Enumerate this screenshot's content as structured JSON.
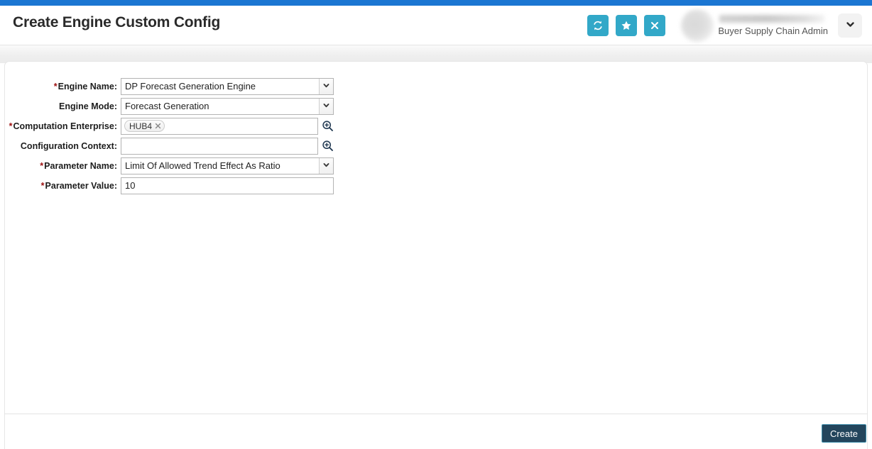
{
  "theme": {
    "accent_blue": "#1b76d2",
    "teal": "#32a8c8",
    "required_red": "#9c0f0f",
    "button_navy": "#23455c",
    "button_border": "#3d8ba8"
  },
  "header": {
    "title": "Create Engine Custom Config",
    "actions": [
      {
        "name": "refresh-button",
        "icon": "refresh-icon",
        "label": "Refresh"
      },
      {
        "name": "favorite-button",
        "icon": "star-icon",
        "label": "Favorite"
      },
      {
        "name": "close-button",
        "icon": "close-icon",
        "label": "Close"
      }
    ],
    "user": {
      "role": "Buyer Supply Chain Admin",
      "menu_icon": "chevron-down-icon"
    }
  },
  "form": {
    "fields": [
      {
        "name": "engine-name",
        "label": "Engine Name:",
        "required": true,
        "type": "select",
        "value": "DP Forecast Generation Engine"
      },
      {
        "name": "engine-mode",
        "label": "Engine Mode:",
        "required": false,
        "type": "select",
        "value": "Forecast Generation"
      },
      {
        "name": "computation-enterprise",
        "label": "Computation Enterprise:",
        "required": true,
        "type": "token-lookup",
        "tokens": [
          "HUB4"
        ],
        "lookup_icon": "search-plus-icon"
      },
      {
        "name": "configuration-context",
        "label": "Configuration Context:",
        "required": false,
        "type": "token-lookup",
        "tokens": [],
        "lookup_icon": "search-plus-icon"
      },
      {
        "name": "parameter-name",
        "label": "Parameter Name:",
        "required": true,
        "type": "select",
        "value": "Limit Of Allowed Trend Effect As Ratio"
      },
      {
        "name": "parameter-value",
        "label": "Parameter Value:",
        "required": false,
        "required_mark": true,
        "type": "text",
        "value": "10"
      }
    ]
  },
  "footer": {
    "create_label": "Create"
  }
}
